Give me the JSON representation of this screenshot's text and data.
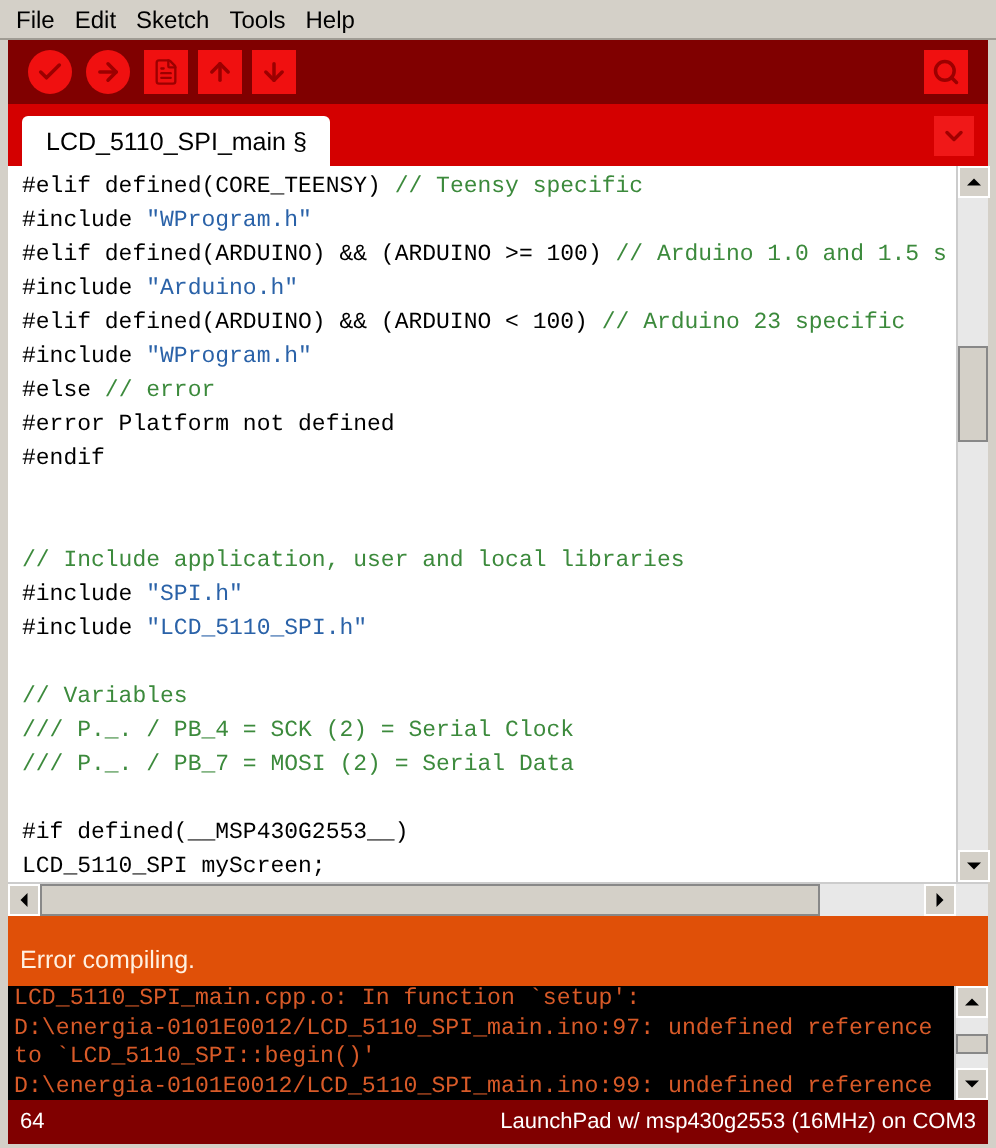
{
  "menu": [
    "File",
    "Edit",
    "Sketch",
    "Tools",
    "Help"
  ],
  "toolbar": [
    {
      "kind": "verify"
    },
    {
      "kind": "upload"
    },
    {
      "kind": "new"
    },
    {
      "kind": "open"
    },
    {
      "kind": "save"
    }
  ],
  "tabs": [
    {
      "label": "LCD_5110_SPI_main §",
      "selected": true
    }
  ],
  "editor": {
    "lines": [
      {
        "kind": "code",
        "segments": [
          {
            "kind": "plain",
            "text": "#elif defined(CORE_TEENSY) "
          },
          {
            "kind": "comment",
            "text": "// Teensy specific"
          }
        ]
      },
      {
        "kind": "code",
        "segments": [
          {
            "kind": "plain",
            "text": "#include "
          },
          {
            "kind": "string",
            "text": "\"WProgram.h\""
          }
        ]
      },
      {
        "kind": "code",
        "segments": [
          {
            "kind": "plain",
            "text": "#elif defined(ARDUINO) && (ARDUINO >= 100) "
          },
          {
            "kind": "comment",
            "text": "// Arduino 1.0 and 1.5 s"
          }
        ]
      },
      {
        "kind": "code",
        "segments": [
          {
            "kind": "plain",
            "text": "#include "
          },
          {
            "kind": "string",
            "text": "\"Arduino.h\""
          }
        ]
      },
      {
        "kind": "code",
        "segments": [
          {
            "kind": "plain",
            "text": "#elif defined(ARDUINO) && (ARDUINO < 100) "
          },
          {
            "kind": "comment",
            "text": "// Arduino 23 specific"
          }
        ]
      },
      {
        "kind": "code",
        "segments": [
          {
            "kind": "plain",
            "text": "#include "
          },
          {
            "kind": "string",
            "text": "\"WProgram.h\""
          }
        ]
      },
      {
        "kind": "code",
        "segments": [
          {
            "kind": "plain",
            "text": "#else "
          },
          {
            "kind": "comment",
            "text": "// error"
          }
        ]
      },
      {
        "kind": "code",
        "segments": [
          {
            "kind": "plain",
            "text": "#error Platform not defined"
          }
        ]
      },
      {
        "kind": "code",
        "segments": [
          {
            "kind": "plain",
            "text": "#endif"
          }
        ]
      },
      {
        "kind": "blank"
      },
      {
        "kind": "blank"
      },
      {
        "kind": "code",
        "segments": [
          {
            "kind": "comment",
            "text": "// Include application, user and local libraries"
          }
        ]
      },
      {
        "kind": "code",
        "segments": [
          {
            "kind": "plain",
            "text": "#include "
          },
          {
            "kind": "string",
            "text": "\"SPI.h\""
          }
        ]
      },
      {
        "kind": "code",
        "segments": [
          {
            "kind": "plain",
            "text": "#include "
          },
          {
            "kind": "string",
            "text": "\"LCD_5110_SPI.h\""
          }
        ]
      },
      {
        "kind": "blank"
      },
      {
        "kind": "code",
        "segments": [
          {
            "kind": "comment",
            "text": "// Variables"
          }
        ]
      },
      {
        "kind": "code",
        "segments": [
          {
            "kind": "comment",
            "text": "/// P._. / PB_4 = SCK (2) = Serial Clock"
          }
        ]
      },
      {
        "kind": "code",
        "segments": [
          {
            "kind": "comment",
            "text": "/// P._. / PB_7 = MOSI (2) = Serial Data"
          }
        ]
      },
      {
        "kind": "blank"
      },
      {
        "kind": "code",
        "segments": [
          {
            "kind": "plain",
            "text": "#if defined(__MSP430G2553__)"
          }
        ]
      },
      {
        "kind": "code",
        "segments": [
          {
            "kind": "plain",
            "text": "LCD_5110_SPI myScreen;"
          }
        ]
      }
    ]
  },
  "status": {
    "message": "Error compiling."
  },
  "console": {
    "lines": [
      "LCD_5110_SPI_main.cpp.o: In function `setup':",
      "D:\\energia-0101E0012/LCD_5110_SPI_main.ino:97: undefined reference",
      "to `LCD_5110_SPI::begin()'",
      "D:\\energia-0101E0012/LCD_5110_SPI_main.ino:99: undefined reference"
    ]
  },
  "footer": {
    "line": "64",
    "board": "LaunchPad w/ msp430g2553 (16MHz) on COM3"
  }
}
